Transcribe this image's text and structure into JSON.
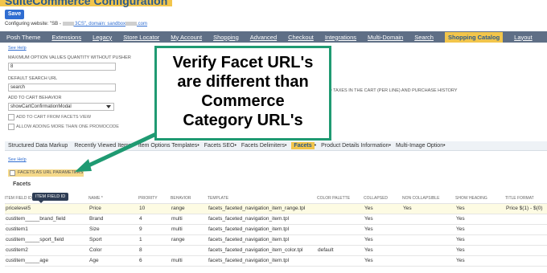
{
  "header": {
    "title": "SuiteCommerce Configuration",
    "save_label": "Save",
    "config_prefix": "Configuring website: \"SB - ",
    "config_mid": " 3CS\", domain: sandbox",
    "config_suffix": ".com"
  },
  "nav": {
    "items": [
      "Posh Theme",
      "Extensions",
      "Legacy",
      "Store Locator",
      "My Account",
      "Shopping",
      "Advanced",
      "Checkout",
      "Integrations",
      "Multi-Domain",
      "Search",
      "Shopping Catalog",
      "Layout"
    ],
    "active_index": 11
  },
  "form": {
    "help_label": "See Help",
    "max_option_label": "MAXIMUM OPTION VALUES QUANTITY WITHOUT PUSHER",
    "max_option_value": "8",
    "search_url_label": "DEFAULT SEARCH URL",
    "search_url_value": "search",
    "cart_behavior_label": "ADD TO CART BEHAVIOR",
    "cart_behavior_value": "showCartConfirmationModal",
    "cb_facets_view": "ADD TO CART FROM FACETS VIEW",
    "cb_promocode": "ALLOW ADDING MORE THAN ONE PROMOCODE",
    "right_note": "ED TAXES IN THE CART (PER LINE) AND PURCHASE HISTORY"
  },
  "subtabs": {
    "items": [
      "Structured Data Markup",
      "Recently Viewed Items",
      "Item Options Templates",
      "Facets SEO",
      "Facets Delimiters",
      "Facets",
      "Product Details Information",
      "Multi-Image Option"
    ],
    "active_index": 5
  },
  "facets": {
    "help_label": "See Help",
    "url_params_label": "FACETS AS URL PARAMETERS",
    "section_title": "Facets",
    "tooltip": "ITEM FIELD ID",
    "columns": [
      "ITEM FIELD ID",
      "NAME *",
      "PRIORITY",
      "BEHAVIOR",
      "TEMPLATE",
      "COLOR PALETTE",
      "COLLAPSED",
      "NON COLLAPSIBLE",
      "SHOW HEADING",
      "TITLE FORMAT"
    ],
    "rows": [
      [
        "pricelevel5",
        "Price",
        "10",
        "range",
        "facets_faceted_navigation_item_range.tpl",
        "",
        "Yes",
        "Yes",
        "Yes",
        "Price $(1) - $(0)"
      ],
      [
        "custitem_____brand_field",
        "Brand",
        "4",
        "multi",
        "facets_faceted_navigation_item.tpl",
        "",
        "Yes",
        "",
        "Yes",
        ""
      ],
      [
        "custitem1",
        "Size",
        "9",
        "multi",
        "facets_faceted_navigation_item.tpl",
        "",
        "Yes",
        "",
        "Yes",
        ""
      ],
      [
        "custitem_____sport_field",
        "Sport",
        "1",
        "range",
        "facets_faceted_navigation_item.tpl",
        "",
        "Yes",
        "",
        "Yes",
        ""
      ],
      [
        "custitem2",
        "Color",
        "8",
        "",
        "facets_faceted_navigation_item_color.tpl",
        "default",
        "Yes",
        "",
        "Yes",
        ""
      ],
      [
        "custitem_____age",
        "Age",
        "6",
        "multi",
        "facets_faceted_navigation_item.tpl",
        "",
        "Yes",
        "",
        "Yes",
        ""
      ]
    ]
  },
  "callout": {
    "lines": [
      "Verify Facet URL's",
      "are different than",
      "Commerce",
      "Category URL's"
    ]
  },
  "colors": {
    "accent": "#f2c54b",
    "nav_bg": "#5f6f86",
    "callout_border": "#1f9a72",
    "save": "#2f6dd1"
  }
}
